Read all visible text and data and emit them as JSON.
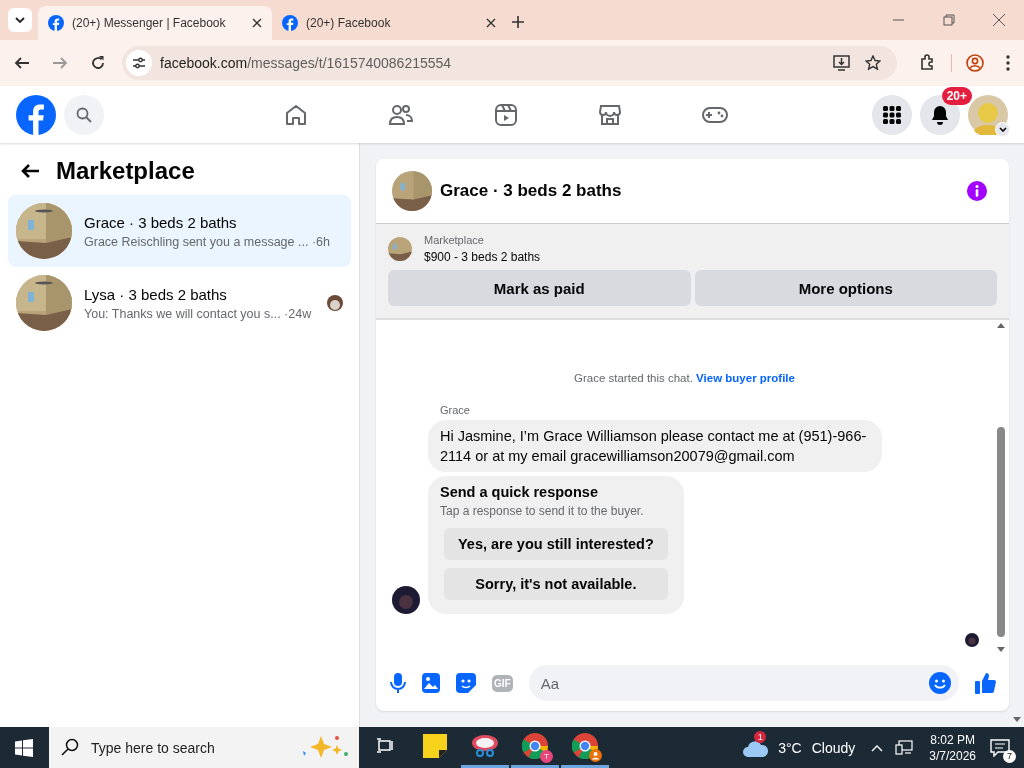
{
  "browser": {
    "tabs": [
      {
        "title": "(20+) Messenger | Facebook",
        "selected": true
      },
      {
        "title": "(20+) Facebook",
        "selected": false
      }
    ],
    "url_host": "facebook.com",
    "url_path": "/messages/t/1615740086215554"
  },
  "topnav": {
    "notifications_badge": "20+"
  },
  "sidebar": {
    "title": "Marketplace",
    "conversations": [
      {
        "name": "Grace · 3 beds 2 baths",
        "preview": "Grace Reischling sent you a message ...",
        "time": "·6h",
        "selected": true,
        "seen_avatar": false
      },
      {
        "name": "Lysa · 3 beds 2 baths",
        "preview": "You: Thanks we will contact you s...",
        "time": "·24w",
        "selected": false,
        "seen_avatar": true
      }
    ]
  },
  "chat": {
    "title": "Grace · 3 beds 2 baths",
    "listing": {
      "label": "Marketplace",
      "summary": "$900 - 3 beds 2 baths"
    },
    "actions": [
      "Mark as paid",
      "More options"
    ],
    "notice": "Grace started this chat.",
    "notice_link": "View buyer profile",
    "sender": "Grace",
    "message": "Hi Jasmine, I’m Grace Williamson please contact me at (951)-966-2114 or at my email gracewilliamson20079@gmail.com",
    "quick_response": {
      "title": "Send a quick response",
      "hint": "Tap a response to send it to the buyer.",
      "options": [
        "Yes, are you still interested?",
        "Sorry, it's not available."
      ]
    },
    "composer": {
      "gif_label": "GIF",
      "placeholder": "Aa"
    }
  },
  "taskbar": {
    "search_placeholder": "Type here to search",
    "apps": [
      {
        "kind": "taskview",
        "active": false
      },
      {
        "kind": "notes",
        "active": false
      },
      {
        "kind": "snip",
        "active": true
      },
      {
        "kind": "chrome",
        "badge": "T",
        "active": true
      },
      {
        "kind": "chrome-profile",
        "active": true
      }
    ],
    "weather_badge": "1",
    "temperature": "3°C",
    "condition": "Cloudy",
    "time": "8:02 PM",
    "date": "3/7/2026",
    "notification_count": "7"
  }
}
